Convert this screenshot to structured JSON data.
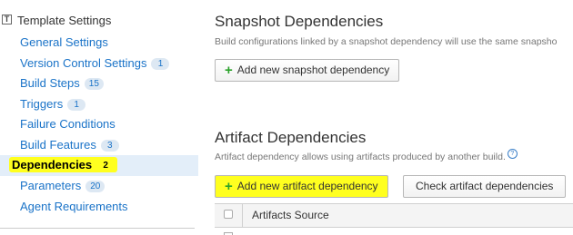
{
  "sidebar": {
    "template_icon": "T",
    "title": "Template Settings",
    "items": [
      {
        "label": "General Settings",
        "badge": null
      },
      {
        "label": "Version Control Settings",
        "badge": "1"
      },
      {
        "label": "Build Steps",
        "badge": "15"
      },
      {
        "label": "Triggers",
        "badge": "1"
      },
      {
        "label": "Failure Conditions",
        "badge": null
      },
      {
        "label": "Build Features",
        "badge": "3"
      },
      {
        "label": "Dependencies",
        "badge": "2"
      },
      {
        "label": "Parameters",
        "badge": "20"
      },
      {
        "label": "Agent Requirements",
        "badge": null
      }
    ]
  },
  "snapshot": {
    "title": "Snapshot Dependencies",
    "description": "Build configurations linked by a snapshot dependency will use the same snapsho",
    "add_button": "Add new snapshot dependency"
  },
  "artifact": {
    "title": "Artifact Dependencies",
    "description": "Artifact dependency allows using artifacts produced by another build.",
    "help_icon": "?",
    "add_button": "Add new artifact dependency",
    "check_button": "Check artifact dependencies",
    "table": {
      "columns": [
        "Artifacts Source"
      ]
    }
  },
  "colors": {
    "link": "#1a73c8",
    "highlight": "#ffff1f",
    "active_bg": "#e3eef9",
    "plus": "#2aa22a"
  }
}
